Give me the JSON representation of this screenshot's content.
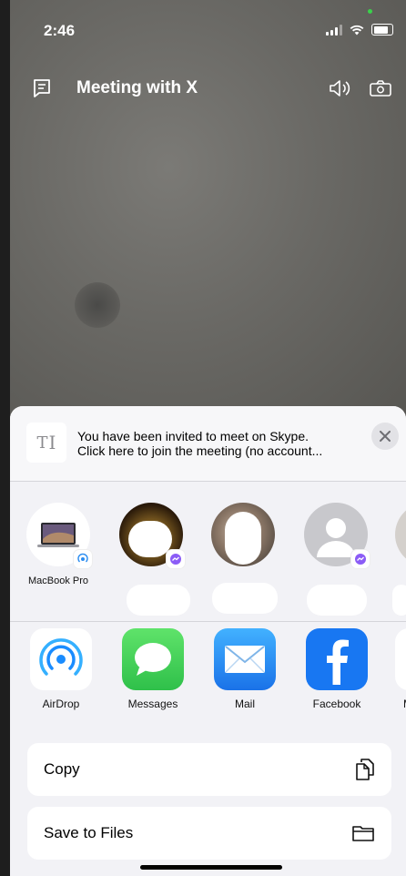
{
  "status_bar": {
    "time": "2:46"
  },
  "header": {
    "chat_icon": "chat-transcript-icon",
    "title": "Meeting with X",
    "speaker_icon": "speaker-icon",
    "switch_camera_icon": "switch-camera-icon"
  },
  "share_sheet": {
    "message": {
      "thumbnail_glyph": "T",
      "text_line1": "You have been invited to meet on Skype.",
      "text_line2": "Click here to join the meeting (no account..."
    },
    "people": [
      {
        "name": "MacBook Pro",
        "avatar": "laptop-avatar",
        "badge": "airdrop-icon"
      },
      {
        "name": "",
        "avatar": "photo-avatar",
        "badge": "messenger-icon"
      },
      {
        "name": "",
        "avatar": "photo-avatar",
        "badge": ""
      },
      {
        "name": "",
        "avatar": "default-person-avatar",
        "badge": "messenger-icon"
      }
    ],
    "apps": [
      {
        "label": "AirDrop",
        "icon": "airdrop-icon",
        "color": "#ffffff"
      },
      {
        "label": "Messages",
        "icon": "messages-icon",
        "color": "#34c759"
      },
      {
        "label": "Mail",
        "icon": "mail-icon",
        "color": "#1e88f5"
      },
      {
        "label": "Facebook",
        "icon": "facebook-icon",
        "color": "#1877f2"
      },
      {
        "label": "M",
        "icon": "more-app-icon",
        "color": "#ffffff"
      }
    ],
    "actions": [
      {
        "label": "Copy",
        "icon": "copy-icon"
      },
      {
        "label": "Save to Files",
        "icon": "folder-icon"
      }
    ]
  },
  "colors": {
    "sheet_bg": "#f2f2f6",
    "video_bg": "#6b6a66"
  }
}
